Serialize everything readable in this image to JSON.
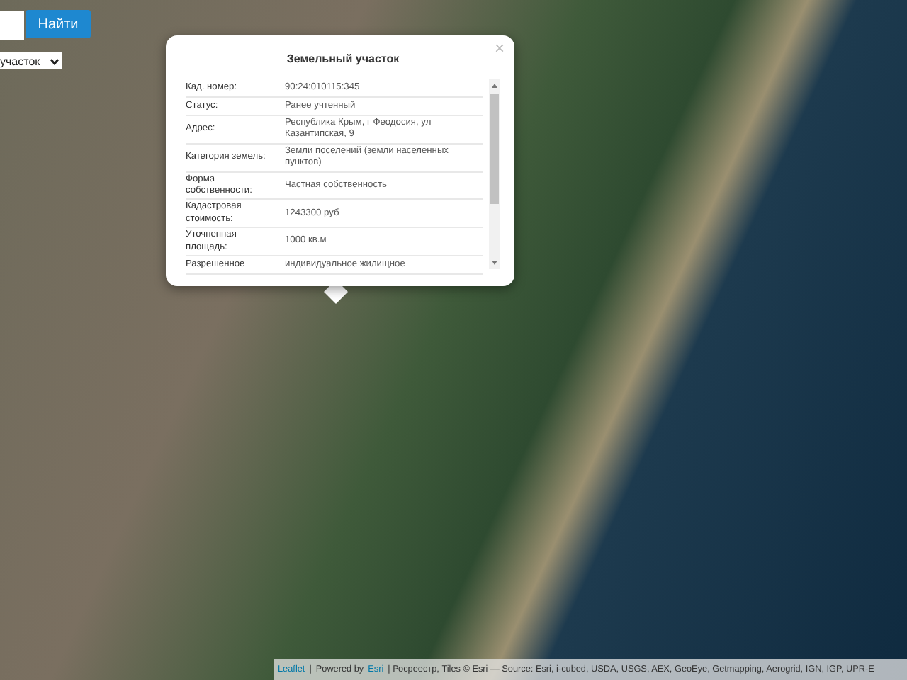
{
  "search": {
    "button": "Найти",
    "select_value": "участок"
  },
  "popup": {
    "title": "Земельный участок",
    "close": "×",
    "rows": [
      {
        "label": "Кад. номер:",
        "value": "90:24:010115:345"
      },
      {
        "label": "Статус:",
        "value": "Ранее учтенный"
      },
      {
        "label": "Адрес:",
        "value": "Республика Крым, г Феодосия, ул Казантипская, 9"
      },
      {
        "label": "Категория земель:",
        "value": "Земли поселений (земли населенных пунктов)"
      },
      {
        "label": "Форма собственности:",
        "value": "Частная собственность"
      },
      {
        "label": "Кадастровая стоимость:",
        "value": "1243300 руб"
      },
      {
        "label": "Уточненная площадь:",
        "value": "1000 кв.м"
      },
      {
        "label": "Разрешенное",
        "value": "индивидуальное жилищное"
      }
    ]
  },
  "attribution": [
    {
      "text": "Leaflet",
      "link": true
    },
    {
      "text": "|",
      "link": false
    },
    {
      "text": "Powered by",
      "link": false
    },
    {
      "text": "Esri",
      "link": true
    },
    {
      "text": "| Росреестр, Tiles © Esri — Source: Esri, i-cubed, USDA, USGS, AEX, GeoEye, Getmapping, Aerogrid, IGN, IGP, UPR-E",
      "link": false
    }
  ]
}
